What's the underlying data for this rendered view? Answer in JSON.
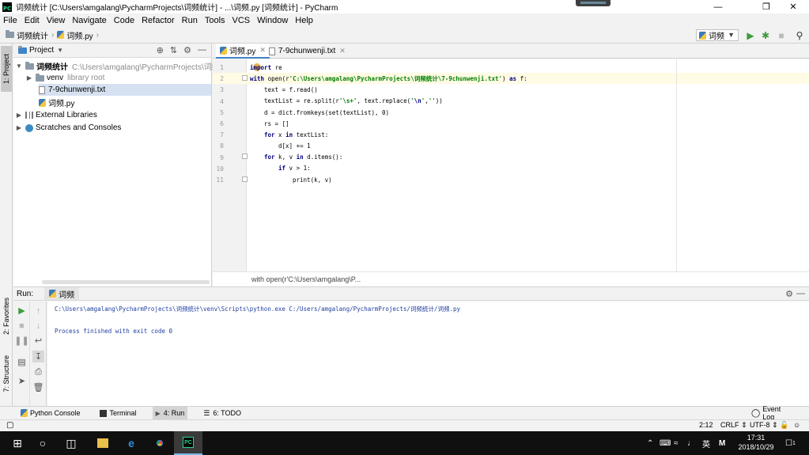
{
  "window": {
    "title": "词频统计 [C:\\Users\\amgalang\\PycharmProjects\\词频统计] - ...\\词频.py [词频统计] - PyCharm",
    "logo_text": "PC"
  },
  "menu": [
    "File",
    "Edit",
    "View",
    "Navigate",
    "Code",
    "Refactor",
    "Run",
    "Tools",
    "VCS",
    "Window",
    "Help"
  ],
  "nav": {
    "project": "词频统计",
    "file": "词频.py",
    "run_config": "词频"
  },
  "left_tabs": {
    "project": "1: Project",
    "favorites": "2: Favorites",
    "structure": "7: Structure"
  },
  "project_panel": {
    "title": "Project",
    "root_name": "词频统计",
    "root_path": "C:\\Users\\amgalang\\PycharmProjects\\词频",
    "venv": "venv",
    "venv_note": "library root",
    "txt_file": "7-9chunwenji.txt",
    "py_file": "词频.py",
    "external": "External Libraries",
    "scratches": "Scratches and Consoles"
  },
  "editor": {
    "tabs": [
      {
        "label": "词频.py"
      },
      {
        "label": "7-9chunwenji.txt"
      }
    ],
    "line_numbers": [
      "1",
      "2",
      "3",
      "4",
      "5",
      "6",
      "7",
      "8",
      "9",
      "10",
      "11"
    ],
    "breadcrumb": "with open(r'C:\\Users\\amgalang\\P..."
  },
  "run": {
    "label": "Run:",
    "tab": "词频",
    "command": "C:\\Users\\amgalang\\PycharmProjects\\词频统计\\venv\\Scripts\\python.exe C:/Users/amgalang/PycharmProjects/词频统计/词频.py",
    "exit": "Process finished with exit code 0"
  },
  "bottom_tabs": {
    "python_console": "Python Console",
    "terminal": "Terminal",
    "run": "4: Run",
    "todo": "6: TODO",
    "event_log": "Event Log"
  },
  "status": {
    "position": "2:12",
    "line_sep": "CRLF",
    "encoding": "UTF-8"
  },
  "taskbar": {
    "time": "17:31",
    "date": "2018/10/29",
    "ime": "英",
    "ime2": "M",
    "notif_count": "1"
  },
  "colors": {
    "accent": "#4083c9",
    "keyword": "#000080",
    "string": "#008000",
    "run_green": "#3c9c3c",
    "caret_line": "#fffbe4"
  },
  "icons": [
    "folder-icon",
    "python-file-icon",
    "text-file-icon",
    "library-icon",
    "scratch-icon",
    "run-icon",
    "debug-icon",
    "stop-icon",
    "search-icon",
    "gear-icon",
    "close-icon"
  ]
}
